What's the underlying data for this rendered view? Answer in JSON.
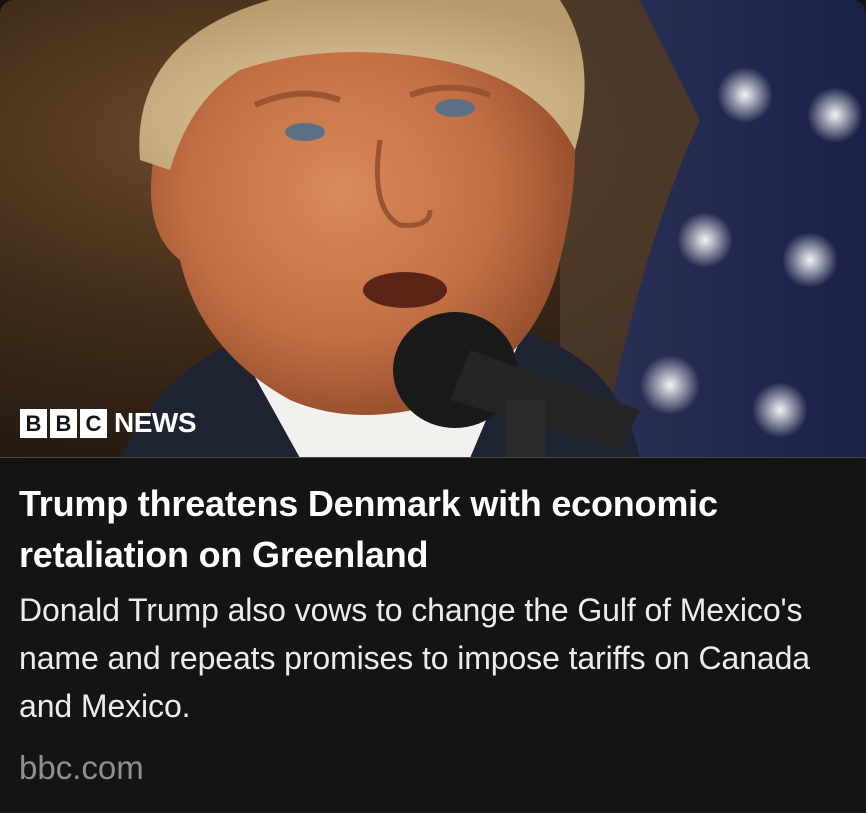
{
  "card": {
    "image": {
      "alt": "Donald Trump speaking into a microphone in front of a US flag",
      "brand_letters": [
        "B",
        "B",
        "C"
      ],
      "brand_word": "NEWS"
    },
    "headline": "Trump threatens Denmark with economic retaliation on Greenland",
    "summary": "Donald Trump also vows to change the Gulf of Mexico's name and repeats promises to impose tariffs on Canada and Mexico.",
    "source": "bbc.com"
  },
  "colors": {
    "background": "#141414",
    "headline": "#ffffff",
    "summary": "#ececec",
    "source": "#8f8f8f",
    "flag_blue": "#1f2a5c"
  },
  "icons": {
    "brand_logo": "bbc-news-logo"
  }
}
